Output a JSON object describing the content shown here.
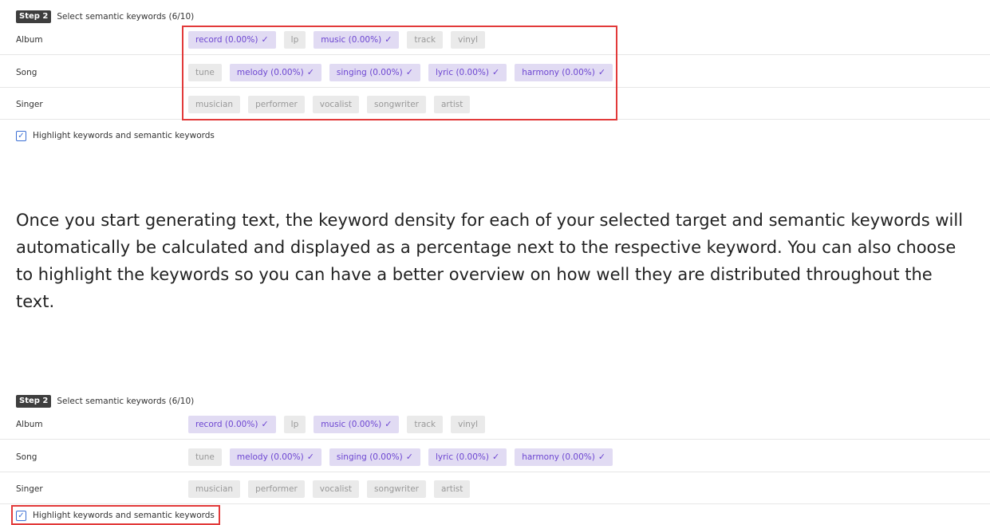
{
  "panels": [
    {
      "step_badge": "Step 2",
      "step_title": "Select semantic keywords (6/10)",
      "rows": [
        {
          "label": "Album",
          "chips": [
            {
              "text": "record (0.00%)",
              "selected": true
            },
            {
              "text": "lp",
              "selected": false
            },
            {
              "text": "music (0.00%)",
              "selected": true
            },
            {
              "text": "track",
              "selected": false
            },
            {
              "text": "vinyl",
              "selected": false
            }
          ]
        },
        {
          "label": "Song",
          "chips": [
            {
              "text": "tune",
              "selected": false
            },
            {
              "text": "melody (0.00%)",
              "selected": true
            },
            {
              "text": "singing (0.00%)",
              "selected": true
            },
            {
              "text": "lyric (0.00%)",
              "selected": true
            },
            {
              "text": "harmony (0.00%)",
              "selected": true
            }
          ]
        },
        {
          "label": "Singer",
          "chips": [
            {
              "text": "musician",
              "selected": false
            },
            {
              "text": "performer",
              "selected": false
            },
            {
              "text": "vocalist",
              "selected": false
            },
            {
              "text": "songwriter",
              "selected": false
            },
            {
              "text": "artist",
              "selected": false
            }
          ]
        }
      ],
      "checkbox_label": "Highlight keywords and semantic keywords",
      "checkbox_checked": true
    },
    {
      "step_badge": "Step 2",
      "step_title": "Select semantic keywords (6/10)",
      "rows": [
        {
          "label": "Album",
          "chips": [
            {
              "text": "record (0.00%)",
              "selected": true
            },
            {
              "text": "lp",
              "selected": false
            },
            {
              "text": "music (0.00%)",
              "selected": true
            },
            {
              "text": "track",
              "selected": false
            },
            {
              "text": "vinyl",
              "selected": false
            }
          ]
        },
        {
          "label": "Song",
          "chips": [
            {
              "text": "tune",
              "selected": false
            },
            {
              "text": "melody (0.00%)",
              "selected": true
            },
            {
              "text": "singing (0.00%)",
              "selected": true
            },
            {
              "text": "lyric (0.00%)",
              "selected": true
            },
            {
              "text": "harmony (0.00%)",
              "selected": true
            }
          ]
        },
        {
          "label": "Singer",
          "chips": [
            {
              "text": "musician",
              "selected": false
            },
            {
              "text": "performer",
              "selected": false
            },
            {
              "text": "vocalist",
              "selected": false
            },
            {
              "text": "songwriter",
              "selected": false
            },
            {
              "text": "artist",
              "selected": false
            }
          ]
        }
      ],
      "checkbox_label": "Highlight keywords and semantic keywords",
      "checkbox_checked": true
    }
  ],
  "check_glyph": "✓",
  "paragraph": "Once you start generating text, the keyword density for each of your selected target and semantic keywords will automatically be calculated and displayed as a percentage next to the respective keyword. You can also choose to highlight the keywords so you can have a better overview on how well they are distributed throughout the text.",
  "colors": {
    "selected_chip_bg": "#e1dbf3",
    "selected_chip_text": "#6d46d1",
    "unselected_chip_bg": "#eaeaea",
    "unselected_chip_text": "#999999",
    "annotation_box": "#e23a3a",
    "checkbox_accent": "#3b6fd4"
  }
}
